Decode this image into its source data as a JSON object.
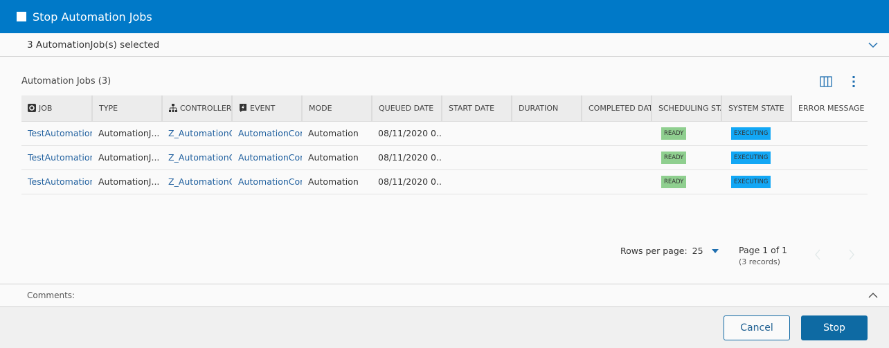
{
  "dialog": {
    "title": "Stop Automation Jobs",
    "selected_text": "3 AutomationJob(s) selected"
  },
  "grid": {
    "title": "Automation Jobs (3)",
    "columns": [
      "JOB",
      "TYPE",
      "CONTROLLER",
      "EVENT",
      "MODE",
      "QUEUED DATE",
      "START DATE",
      "DURATION",
      "COMPLETED DATE",
      "SCHEDULING STATE",
      "SYSTEM STATE",
      "ERROR MESSAGE"
    ],
    "rows": [
      {
        "job": "TestAutomation",
        "type": "AutomationJ...",
        "controller": "Z_AutomationC",
        "event": "AutomationCor",
        "mode": "Automation",
        "queued": "08/11/2020 0...",
        "scheduling": "READY",
        "system": "EXECUTING"
      },
      {
        "job": "TestAutomation",
        "type": "AutomationJ...",
        "controller": "Z_AutomationC",
        "event": "AutomationCor",
        "mode": "Automation",
        "queued": "08/11/2020 0...",
        "scheduling": "READY",
        "system": "EXECUTING"
      },
      {
        "job": "TestAutomation",
        "type": "AutomationJ...",
        "controller": "Z_AutomationC",
        "event": "AutomationCor",
        "mode": "Automation",
        "queued": "08/11/2020 0...",
        "scheduling": "READY",
        "system": "EXECUTING"
      }
    ]
  },
  "pagination": {
    "rows_label": "Rows per page:",
    "rows_value": "25",
    "page_text": "Page 1 of 1",
    "records_text": "(3 records)"
  },
  "comments": {
    "label": "Comments:"
  },
  "buttons": {
    "cancel": "Cancel",
    "stop": "Stop"
  },
  "colors": {
    "header": "#0079c8",
    "ready": "#8fcf8f",
    "executing": "#12a7f5",
    "primary": "#0e6aa3"
  }
}
